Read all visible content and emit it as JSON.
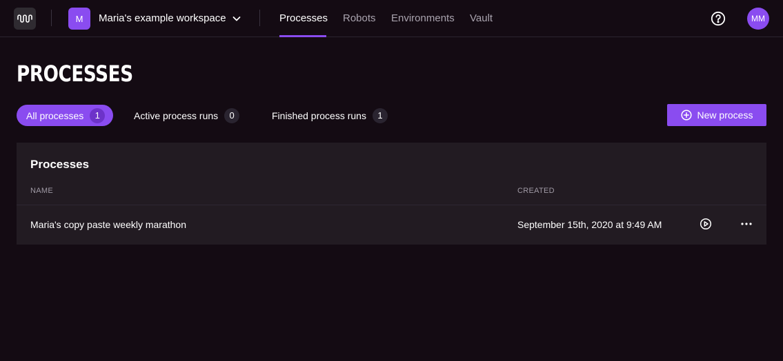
{
  "workspace": {
    "initial": "M",
    "name": "Maria's example workspace"
  },
  "nav": {
    "tabs": [
      {
        "label": "Processes",
        "active": true
      },
      {
        "label": "Robots",
        "active": false
      },
      {
        "label": "Environments",
        "active": false
      },
      {
        "label": "Vault",
        "active": false
      }
    ]
  },
  "user": {
    "initials": "MM"
  },
  "page": {
    "title": "PROCESSES"
  },
  "filters": [
    {
      "label": "All processes",
      "count": "1",
      "active": true
    },
    {
      "label": "Active process runs",
      "count": "0",
      "active": false
    },
    {
      "label": "Finished process runs",
      "count": "1",
      "active": false
    }
  ],
  "actions": {
    "new_process_label": "New process"
  },
  "table": {
    "title": "Processes",
    "columns": {
      "name": "NAME",
      "created": "CREATED"
    },
    "rows": [
      {
        "name": "Maria's copy paste weekly marathon",
        "created": "September 15th, 2020 at 9:49 AM"
      }
    ]
  },
  "colors": {
    "accent": "#8a4cf0",
    "background": "#140b13",
    "card": "#221b22"
  },
  "icons": [
    "app-logo-icon",
    "chevron-down-icon",
    "help-icon",
    "plus-circle-icon",
    "play-icon",
    "more-icon"
  ]
}
